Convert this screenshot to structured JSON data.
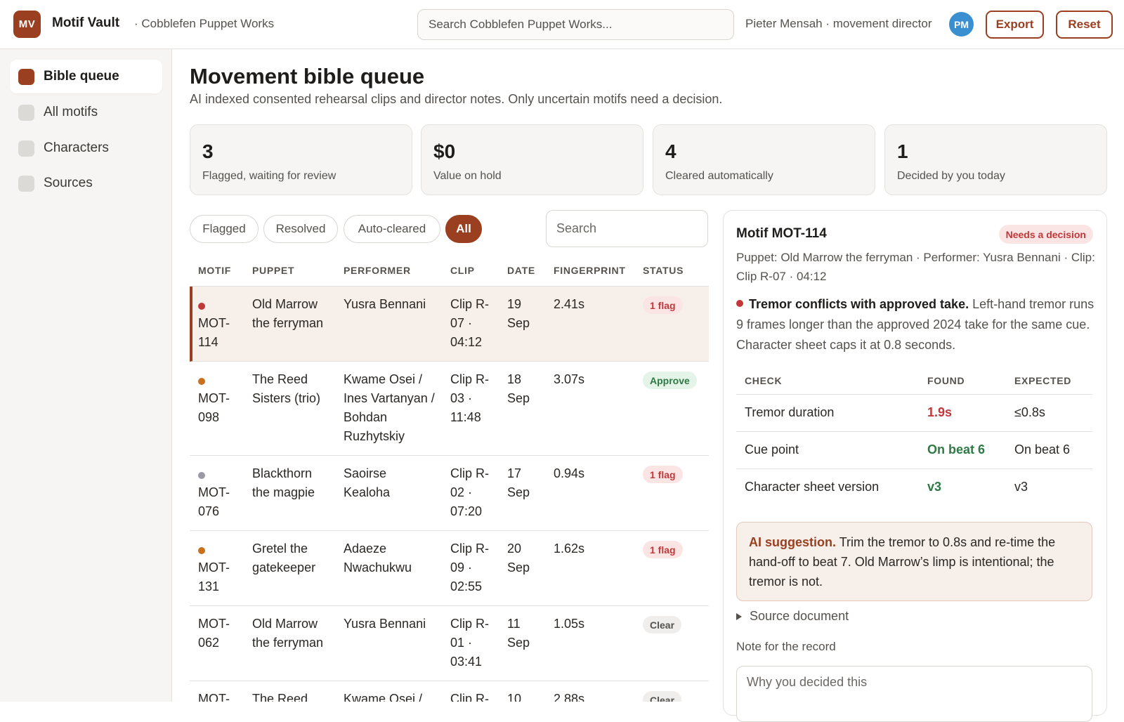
{
  "app": {
    "logo": "MV",
    "name": "Motif Vault",
    "workspace": "· Cobblefen Puppet Works",
    "search_placeholder": "Search Cobblefen Puppet Works...",
    "user": "Pieter Mensah · movement director",
    "avatar": "PM",
    "export_label": "Export",
    "reset_label": "Reset"
  },
  "sidebar": {
    "items": [
      {
        "label": "Bible queue",
        "active": true
      },
      {
        "label": "All motifs"
      },
      {
        "label": "Characters"
      },
      {
        "label": "Sources"
      }
    ]
  },
  "page": {
    "title": "Movement bible queue",
    "subtitle": "AI indexed consented rehearsal clips and director notes. Only uncertain motifs need a decision."
  },
  "stats": [
    {
      "value": "3",
      "label": "Flagged, waiting for review"
    },
    {
      "value": "$0",
      "label": "Value on hold"
    },
    {
      "value": "4",
      "label": "Cleared automatically"
    },
    {
      "value": "1",
      "label": "Decided by you today"
    }
  ],
  "filters": {
    "chips": [
      "Flagged",
      "Resolved",
      "Auto-cleared",
      "All"
    ],
    "active": "All",
    "search_placeholder": "Search"
  },
  "table": {
    "headers": [
      "MOTIF",
      "PUPPET",
      "PERFORMER",
      "CLIP",
      "DATE",
      "FINGERPRINT",
      "STATUS"
    ],
    "rows": [
      {
        "motif": "MOT-114",
        "puppet": "Old Marrow the ferryman",
        "performer": "Yusra Bennani",
        "clip": "Clip R-07 · 04:12",
        "date": "19 Sep",
        "fingerprint": "2.41s",
        "status": "1 flag",
        "dot": "#c0383a"
      },
      {
        "motif": "MOT-098",
        "puppet": "The Reed Sisters (trio)",
        "performer": "Kwame Osei / Ines Vartanyan / Bohdan Ruzhytskiy",
        "clip": "Clip R-03 · 11:48",
        "date": "18 Sep",
        "fingerprint": "3.07s",
        "status": "Approve",
        "dot": "#c8701e"
      },
      {
        "motif": "MOT-076",
        "puppet": "Blackthorn the magpie",
        "performer": "Saoirse Kealoha",
        "clip": "Clip R-02 · 07:20",
        "date": "17 Sep",
        "fingerprint": "0.94s",
        "status": "1 flag",
        "dot": "#9b99a6"
      },
      {
        "motif": "MOT-131",
        "puppet": "Gretel the gatekeeper",
        "performer": "Adaeze Nwachukwu",
        "clip": "Clip R-09 · 02:55",
        "date": "20 Sep",
        "fingerprint": "1.62s",
        "status": "1 flag",
        "dot": "#c8701e"
      },
      {
        "motif": "MOT-062",
        "puppet": "Old Marrow the ferryman",
        "performer": "Yusra Bennani",
        "clip": "Clip R-01 · 03:41",
        "date": "11 Sep",
        "fingerprint": "1.05s",
        "status": "Clear"
      },
      {
        "motif": "MOT-",
        "puppet": "The Reed",
        "performer": "Kwame Osei /",
        "clip": "Clip R-",
        "date": "10",
        "fingerprint": "2.88s",
        "status": "Clear"
      }
    ]
  },
  "detail": {
    "title": "Motif MOT-114",
    "pill": "Needs a decision",
    "meta": "Puppet: Old Marrow the ferryman · Performer: Yusra Bennani · Clip: Clip R-07 · 04:12",
    "headline": "Tremor conflicts with approved take.",
    "description": "Left-hand tremor runs 9 frames longer than the approved 2024 take for the same cue. Character sheet caps it at 0.8 seconds.",
    "checks": {
      "headers": [
        "CHECK",
        "FOUND",
        "EXPECTED"
      ],
      "rows": [
        {
          "check": "Tremor duration",
          "found": "1.9s",
          "expected": "≤0.8s",
          "ok": false
        },
        {
          "check": "Cue point",
          "found": "On beat 6",
          "expected": "On beat 6",
          "ok": true
        },
        {
          "check": "Character sheet version",
          "found": "v3",
          "expected": "v3",
          "ok": true
        }
      ]
    },
    "ai_label": "AI suggestion.",
    "ai_text": "Trim the tremor to 0.8s and re-time the hand-off to beat 7. Old Marrow’s limp is intentional; the tremor is not.",
    "source_label": "Source document",
    "note_label": "Note for the record",
    "note_placeholder": "Why you decided this"
  },
  "colors": {
    "accent": "#9a3f1f",
    "flag": "#c0383a",
    "ok": "#2d7a45",
    "avatar": "#3a8fd1"
  }
}
